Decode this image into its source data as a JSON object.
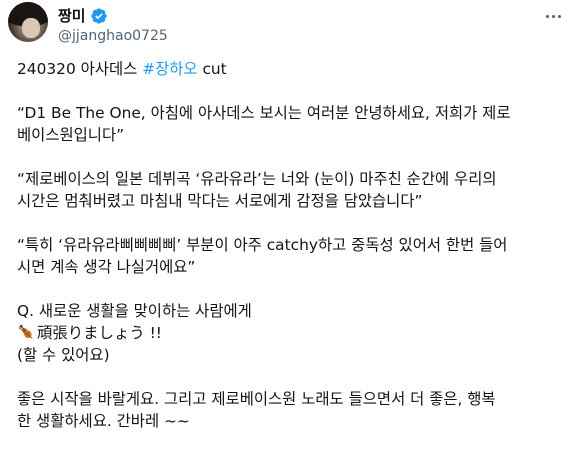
{
  "author": {
    "display_name": "짱미",
    "handle": "@jjanghao0725",
    "verified": true,
    "verified_color": "#1d9bf0"
  },
  "tweet": {
    "line1_prefix": "240320 아사데스 ",
    "hashtag": "#장하오",
    "line1_suffix": " cut",
    "p1_l1": "“D1 Be The One, 아침에 아사데스 보시는 여러분 안녕하세요, 저희가 제로",
    "p1_l2": "베이스원입니다”",
    "p2_l1": "“제로베이스의 일본 데뷔곡 ‘유라유라’는 너와 (눈이) 마주친 순간에 우리의",
    "p2_l2": "시간은 멈춰버렸고 마침내 막다는 서로에게 감정을 담았습니다”",
    "p3_l1": "“특히 ‘유라유라삐삐삐삐’ 부분이 아주 catchy하고 중독성 있어서 한번 들어",
    "p3_l2": "시면 계속 생각 나실거에요”",
    "q_l1": "Q. 새로운 생활을 맞이하는 사람에게",
    "q_l2": "頑張りましょう !!",
    "q_l3": "(할 수 있어요)",
    "end_l1": "좋은 시작을 바랄게요. 그리고 제로베이스원 노래도 들으면서 더 좋은, 행복",
    "end_l2": "한 생활하세요. 간바레 ~~"
  },
  "icons": {
    "verified": "verified-badge-icon",
    "more": "more-options-icon",
    "violin": "violin-emoji-icon"
  },
  "colors": {
    "link": "#1d9bf0",
    "text": "#0f1419",
    "muted": "#536471"
  }
}
